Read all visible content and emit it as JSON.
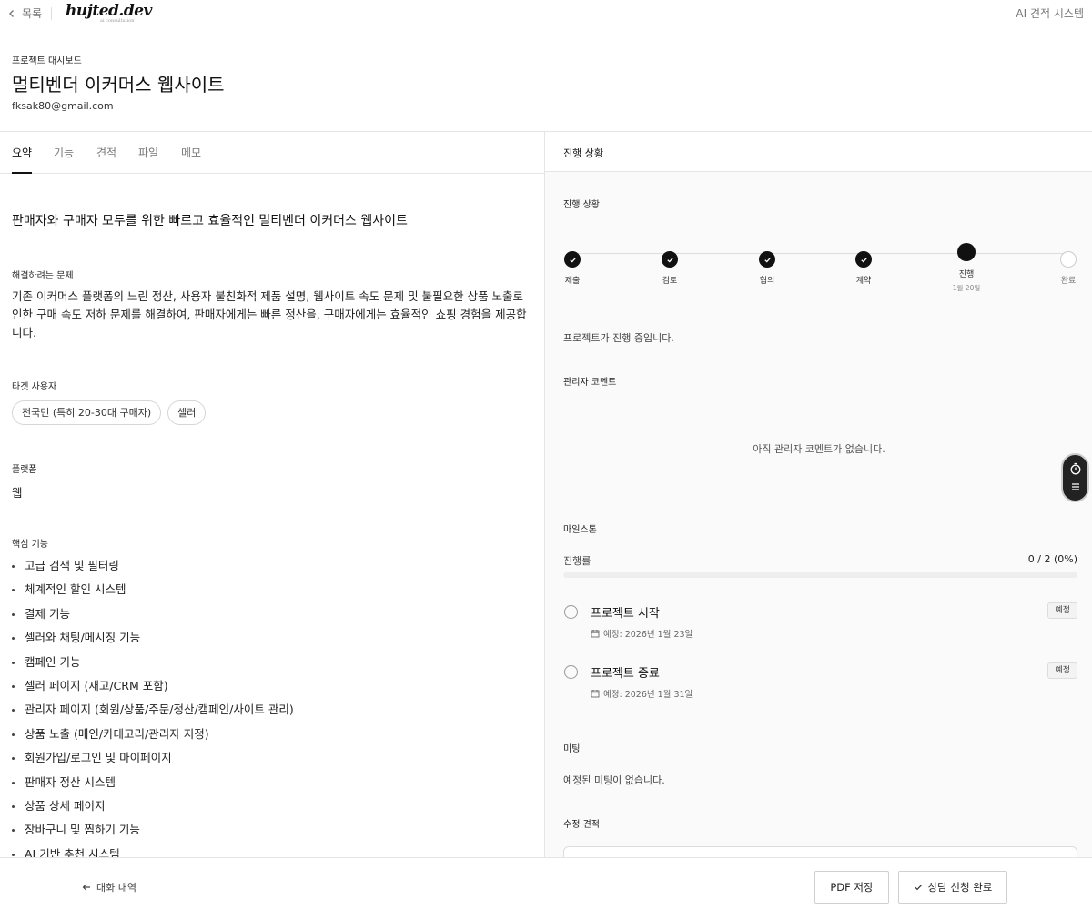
{
  "topbar": {
    "back_label": "목록",
    "logo_text": "hujted.dev",
    "logo_sub": "ai consultation",
    "right_label": "AI 견적 시스템"
  },
  "header": {
    "kicker": "프로젝트 대시보드",
    "title": "멀티벤더 이커머스 웹사이트",
    "email": "fksak80@gmail.com"
  },
  "tabs": [
    "요약",
    "기능",
    "견적",
    "파일",
    "메모"
  ],
  "summary": {
    "tagline": "판매자와 구매자 모두를 위한 빠르고 효율적인 멀티벤더 이커머스 웹사이트",
    "problem_label": "해결하려는 문제",
    "problem_text": "기존 이커머스 플랫폼의 느린 정산, 사용자 불친화적 제품 설명, 웹사이트 속도 문제 및 불필요한 상품 노출로 인한 구매 속도 저하 문제를 해결하여, 판매자에게는 빠른 정산을, 구매자에게는 효율적인 쇼핑 경험을 제공합니다.",
    "target_label": "타겟 사용자",
    "targets": [
      "전국민 (특히 20-30대 구매자)",
      "셀러"
    ],
    "platform_label": "플랫폼",
    "platform": "웹",
    "features_label": "핵심 기능",
    "features": [
      "고급 검색 및 필터링",
      "체계적인 할인 시스템",
      "결제 기능",
      "셀러와 채팅/메시징 기능",
      "캠페인 기능",
      "셀러 페이지 (재고/CRM 포함)",
      "관리자 페이지 (회원/상품/주문/정산/캠페인/사이트 관리)",
      "상품 노출 (메인/카테고리/관리자 지정)",
      "회원가입/로그인 및 마이페이지",
      "판매자 정산 시스템",
      "상품 상세 페이지",
      "장바구니 및 찜하기 기능",
      "AI 기반 추천 시스템"
    ]
  },
  "status": {
    "panel_title": "진행 상황",
    "section_label": "진행 상황",
    "steps": [
      {
        "label": "제출",
        "state": "done",
        "date": ""
      },
      {
        "label": "검토",
        "state": "done",
        "date": ""
      },
      {
        "label": "협의",
        "state": "done",
        "date": ""
      },
      {
        "label": "계약",
        "state": "done",
        "date": ""
      },
      {
        "label": "진행",
        "state": "current",
        "date": "1월 20일"
      },
      {
        "label": "완료",
        "state": "todo",
        "date": ""
      }
    ],
    "status_text": "프로젝트가 진행 중입니다.",
    "comment_label": "관리자 코멘트",
    "comment_empty": "아직 관리자 코멘트가 없습니다.",
    "milestone_label": "마일스톤",
    "progress_label": "진행률",
    "progress_value": "0 / 2 (0%)",
    "progress_fraction": 0,
    "milestones": [
      {
        "title": "프로젝트 시작",
        "date": "예정: 2026년 1월 23일",
        "badge": "예정"
      },
      {
        "title": "프로젝트 종료",
        "date": "예정: 2026년 1월 31일",
        "badge": "예정"
      }
    ],
    "meeting_label": "미팅",
    "meeting_empty": "예정된 미팅이 없습니다.",
    "revision_label": "수정 견적"
  },
  "footer": {
    "back_label": "대화 내역",
    "pdf_label": "PDF 저장",
    "done_label": "상담 신청 완료"
  },
  "colors": {
    "accent": "#111111",
    "border": "#e5e5e5",
    "panel_bg": "#fafafa"
  }
}
